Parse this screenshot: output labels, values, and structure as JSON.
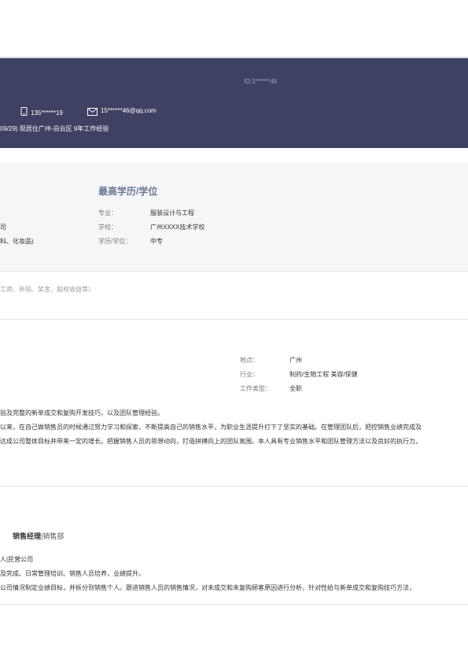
{
  "header": {
    "id_text": "ID:3******48",
    "phone": "135******19",
    "email": "15******46@qq.com",
    "info_line": "09/29)   现居住广州-白云区 9年工作经验"
  },
  "education": {
    "title": "最高学历/学位",
    "left_line1": "司",
    "left_line2": "科、化妆品)",
    "major_label": "专业：",
    "major_value": "服装设计与工程",
    "school_label": "学校：",
    "school_value": "广州XXXX技术学校",
    "degree_label": "学历/学位：",
    "degree_value": "中专"
  },
  "salary_note": "工资、补贴、奖金、股权收益等）",
  "job_intention": {
    "location_label": "地点：",
    "location_value": "广州",
    "industry_label": "行业：",
    "industry_value": "制药/生物工程   美容/保健",
    "type_label": "工作类型：",
    "type_value": "全职"
  },
  "self_eval": {
    "line1": "验及完整的新单成交和复购开发技巧，以及团队管理经验。",
    "line2": "以来，在自己做销售员的时候通过努力学习和探索，不断提高自己的销售水平，为职业生涯提升打下了坚实的基础。在管理团队后，把控销售业绩完成及",
    "line3": "达成公司整体目标并带来一定的增长。把握销售人员的思想动向，打造拼搏向上的团队氛围。本人具有专业销售水平和团队管理方法以及良好的执行力，"
  },
  "work": {
    "position": "销售经理",
    "department": "|销售部",
    "company": "人|民营公司",
    "duty1": "及完成、日常管理培训、销售人员培养，业绩提升。",
    "duty2": "公司情况制定业绩目标，并拆分到销售个人。跟进销售人员的销售情况，对未成交和未复购顾客原因进行分析，针对性给与新单成交和复购技巧方法，"
  },
  "icons": {
    "phone": "phone-icon",
    "email": "mail-icon"
  }
}
